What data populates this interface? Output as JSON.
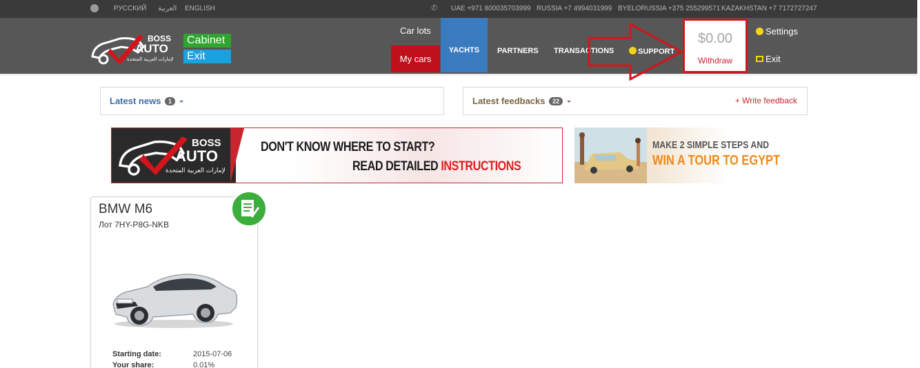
{
  "topbar": {
    "languages": [
      "РУССКИЙ",
      "العربية",
      "ENGLISH"
    ],
    "phones": [
      "UAE +971 800035703999",
      "RUSSIA +7 4994031999",
      "BYELORUSSIA +375 255299571",
      "KAZAKHSTAN +7 7172727247"
    ]
  },
  "header": {
    "logo_text_top": "BOSS",
    "logo_text_main": "AUTO",
    "logo_text_arabic": "لإمارات العربية المتحدة",
    "cabinet_label": "Cabinet",
    "exit_label": "Exit",
    "nav": {
      "car_lots": "Car lots",
      "my_cars": "My cars",
      "yachts": "YACHTS",
      "partners": "PARTNERS",
      "transactions": "TRANSACTIONS",
      "support": "SUPPORT"
    },
    "balance": "$0.00",
    "withdraw": "Withdraw",
    "settings": "Settings",
    "exit": "Exit"
  },
  "news": {
    "label": "Latest news",
    "count": "1"
  },
  "feedbacks": {
    "label": "Latest feedbacks",
    "count": "22",
    "write": "+ Write feedback"
  },
  "banner_instructions": {
    "logo_top": "BOSS",
    "logo_main": "AUTO",
    "logo_arabic": "لإمارات العربية المتحدة",
    "line1": "DON'T KNOW WHERE TO START?",
    "line2_prefix": "READ DETAILED",
    "line2_highlight": "INSTRUCTIONS"
  },
  "banner_tour": {
    "line1": "MAKE 2 SIMPLE STEPS AND",
    "line2": "WIN A TOUR TO EGYPT"
  },
  "car_card": {
    "title": "BMW M6",
    "lot": "Лот 7HY-P8G-NKB",
    "rows": [
      {
        "key": "Starting date:",
        "value": "2015-07-06"
      },
      {
        "key": "Your share:",
        "value": "0.01%"
      }
    ]
  },
  "colors": {
    "header_bg": "#575757",
    "topbar_bg": "#3a3a3a",
    "accent_red": "#c0101c",
    "yachts_blue": "#3a7bbf",
    "cabinet_green": "#2fa52f",
    "exit_blue": "#1aa1e0",
    "annotation_red": "#d4141c"
  }
}
